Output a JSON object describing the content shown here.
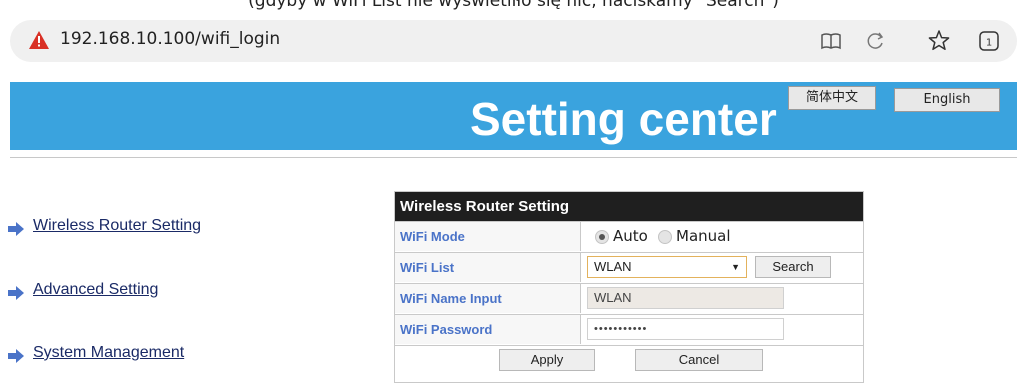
{
  "caption": "(gdyby w WiFi List nie wyświetliło się nic, naciskamy \"Search\")",
  "browser": {
    "url": "192.168.10.100/wifi_login",
    "icons": [
      "security-warning-icon",
      "reader-mode-icon",
      "reload-icon",
      "bookmark-star-icon",
      "tabs-icon"
    ],
    "tab_count": "1"
  },
  "banner": {
    "title": "Setting center",
    "lang_chinese": "简体中文",
    "lang_english": "English",
    "color": "#3aa3de"
  },
  "nav": {
    "items": [
      {
        "label": "Wireless Router Setting"
      },
      {
        "label": "Advanced Setting"
      },
      {
        "label": "System Management"
      }
    ],
    "arrow_color": "#4a73c8"
  },
  "panel": {
    "title": "Wireless Router Setting",
    "rows": {
      "mode": {
        "label": "WiFi Mode",
        "options": [
          "Auto",
          "Manual"
        ],
        "selected": "Auto"
      },
      "list": {
        "label": "WiFi List",
        "value": "WLAN",
        "button": "Search"
      },
      "name": {
        "label": "WiFi Name Input",
        "value": "WLAN"
      },
      "password": {
        "label": "WiFi Password",
        "value": "•••••••••••"
      }
    },
    "apply": "Apply",
    "cancel": "Cancel"
  }
}
